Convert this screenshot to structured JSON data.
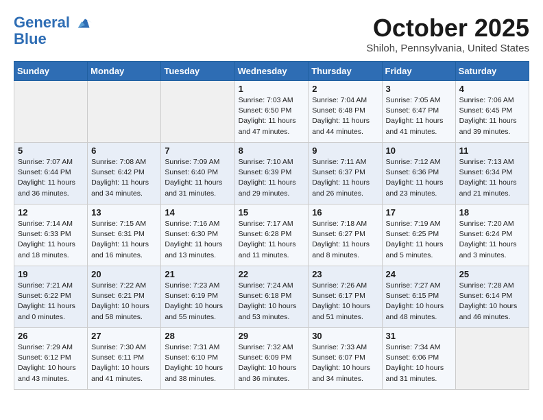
{
  "header": {
    "logo_line1": "General",
    "logo_line2": "Blue",
    "month": "October 2025",
    "location": "Shiloh, Pennsylvania, United States"
  },
  "weekdays": [
    "Sunday",
    "Monday",
    "Tuesday",
    "Wednesday",
    "Thursday",
    "Friday",
    "Saturday"
  ],
  "weeks": [
    [
      {
        "day": "",
        "info": ""
      },
      {
        "day": "",
        "info": ""
      },
      {
        "day": "",
        "info": ""
      },
      {
        "day": "1",
        "info": "Sunrise: 7:03 AM\nSunset: 6:50 PM\nDaylight: 11 hours and 47 minutes."
      },
      {
        "day": "2",
        "info": "Sunrise: 7:04 AM\nSunset: 6:48 PM\nDaylight: 11 hours and 44 minutes."
      },
      {
        "day": "3",
        "info": "Sunrise: 7:05 AM\nSunset: 6:47 PM\nDaylight: 11 hours and 41 minutes."
      },
      {
        "day": "4",
        "info": "Sunrise: 7:06 AM\nSunset: 6:45 PM\nDaylight: 11 hours and 39 minutes."
      }
    ],
    [
      {
        "day": "5",
        "info": "Sunrise: 7:07 AM\nSunset: 6:44 PM\nDaylight: 11 hours and 36 minutes."
      },
      {
        "day": "6",
        "info": "Sunrise: 7:08 AM\nSunset: 6:42 PM\nDaylight: 11 hours and 34 minutes."
      },
      {
        "day": "7",
        "info": "Sunrise: 7:09 AM\nSunset: 6:40 PM\nDaylight: 11 hours and 31 minutes."
      },
      {
        "day": "8",
        "info": "Sunrise: 7:10 AM\nSunset: 6:39 PM\nDaylight: 11 hours and 29 minutes."
      },
      {
        "day": "9",
        "info": "Sunrise: 7:11 AM\nSunset: 6:37 PM\nDaylight: 11 hours and 26 minutes."
      },
      {
        "day": "10",
        "info": "Sunrise: 7:12 AM\nSunset: 6:36 PM\nDaylight: 11 hours and 23 minutes."
      },
      {
        "day": "11",
        "info": "Sunrise: 7:13 AM\nSunset: 6:34 PM\nDaylight: 11 hours and 21 minutes."
      }
    ],
    [
      {
        "day": "12",
        "info": "Sunrise: 7:14 AM\nSunset: 6:33 PM\nDaylight: 11 hours and 18 minutes."
      },
      {
        "day": "13",
        "info": "Sunrise: 7:15 AM\nSunset: 6:31 PM\nDaylight: 11 hours and 16 minutes."
      },
      {
        "day": "14",
        "info": "Sunrise: 7:16 AM\nSunset: 6:30 PM\nDaylight: 11 hours and 13 minutes."
      },
      {
        "day": "15",
        "info": "Sunrise: 7:17 AM\nSunset: 6:28 PM\nDaylight: 11 hours and 11 minutes."
      },
      {
        "day": "16",
        "info": "Sunrise: 7:18 AM\nSunset: 6:27 PM\nDaylight: 11 hours and 8 minutes."
      },
      {
        "day": "17",
        "info": "Sunrise: 7:19 AM\nSunset: 6:25 PM\nDaylight: 11 hours and 5 minutes."
      },
      {
        "day": "18",
        "info": "Sunrise: 7:20 AM\nSunset: 6:24 PM\nDaylight: 11 hours and 3 minutes."
      }
    ],
    [
      {
        "day": "19",
        "info": "Sunrise: 7:21 AM\nSunset: 6:22 PM\nDaylight: 11 hours and 0 minutes."
      },
      {
        "day": "20",
        "info": "Sunrise: 7:22 AM\nSunset: 6:21 PM\nDaylight: 10 hours and 58 minutes."
      },
      {
        "day": "21",
        "info": "Sunrise: 7:23 AM\nSunset: 6:19 PM\nDaylight: 10 hours and 55 minutes."
      },
      {
        "day": "22",
        "info": "Sunrise: 7:24 AM\nSunset: 6:18 PM\nDaylight: 10 hours and 53 minutes."
      },
      {
        "day": "23",
        "info": "Sunrise: 7:26 AM\nSunset: 6:17 PM\nDaylight: 10 hours and 51 minutes."
      },
      {
        "day": "24",
        "info": "Sunrise: 7:27 AM\nSunset: 6:15 PM\nDaylight: 10 hours and 48 minutes."
      },
      {
        "day": "25",
        "info": "Sunrise: 7:28 AM\nSunset: 6:14 PM\nDaylight: 10 hours and 46 minutes."
      }
    ],
    [
      {
        "day": "26",
        "info": "Sunrise: 7:29 AM\nSunset: 6:12 PM\nDaylight: 10 hours and 43 minutes."
      },
      {
        "day": "27",
        "info": "Sunrise: 7:30 AM\nSunset: 6:11 PM\nDaylight: 10 hours and 41 minutes."
      },
      {
        "day": "28",
        "info": "Sunrise: 7:31 AM\nSunset: 6:10 PM\nDaylight: 10 hours and 38 minutes."
      },
      {
        "day": "29",
        "info": "Sunrise: 7:32 AM\nSunset: 6:09 PM\nDaylight: 10 hours and 36 minutes."
      },
      {
        "day": "30",
        "info": "Sunrise: 7:33 AM\nSunset: 6:07 PM\nDaylight: 10 hours and 34 minutes."
      },
      {
        "day": "31",
        "info": "Sunrise: 7:34 AM\nSunset: 6:06 PM\nDaylight: 10 hours and 31 minutes."
      },
      {
        "day": "",
        "info": ""
      }
    ]
  ]
}
